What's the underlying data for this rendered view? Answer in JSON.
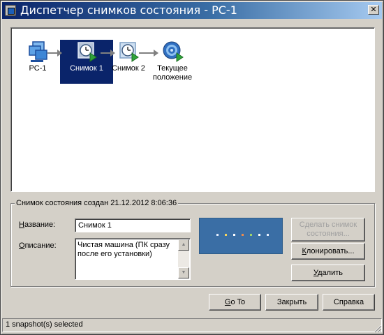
{
  "window": {
    "title": "Диспетчер снимков состояния - PC-1",
    "close_glyph": "✕"
  },
  "tree": {
    "nodes": [
      {
        "label": "PC-1",
        "icon": "vm-icon"
      },
      {
        "label": "Снимок 1",
        "icon": "snapshot-clock-icon",
        "selected": true
      },
      {
        "label": "Снимок 2",
        "icon": "snapshot-clock-icon"
      },
      {
        "label_line1": "Текущее",
        "label_line2": "положение",
        "icon": "current-position-target-icon"
      }
    ]
  },
  "details": {
    "legend": "Снимок состояния создан 21.12.2012 8:06:36",
    "name_label_prefix": "Н",
    "name_label_rest": "азвание:",
    "name_value": "Снимок 1",
    "desc_label_prefix": "О",
    "desc_label_rest": "писание:",
    "desc_value": "Чистая машина (ПК сразу после его установки)"
  },
  "buttons": {
    "take_snapshot_line1": "Сделать снимок",
    "take_snapshot_line2": "состояния...",
    "clone_prefix": "К",
    "clone_rest": "лонировать...",
    "delete_prefix": "У",
    "delete_rest": "далить",
    "goto_prefix": "G",
    "goto_rest": "o To",
    "close": "Закрыть",
    "help": "Справка"
  },
  "status": {
    "text": "1 snapshot(s) selected"
  },
  "colors": {
    "titlebar_start": "#0a246a",
    "titlebar_end": "#a6caf0",
    "selection": "#0a246a",
    "window_bg": "#d4d0c8",
    "preview_bg": "#3a6ea5"
  }
}
